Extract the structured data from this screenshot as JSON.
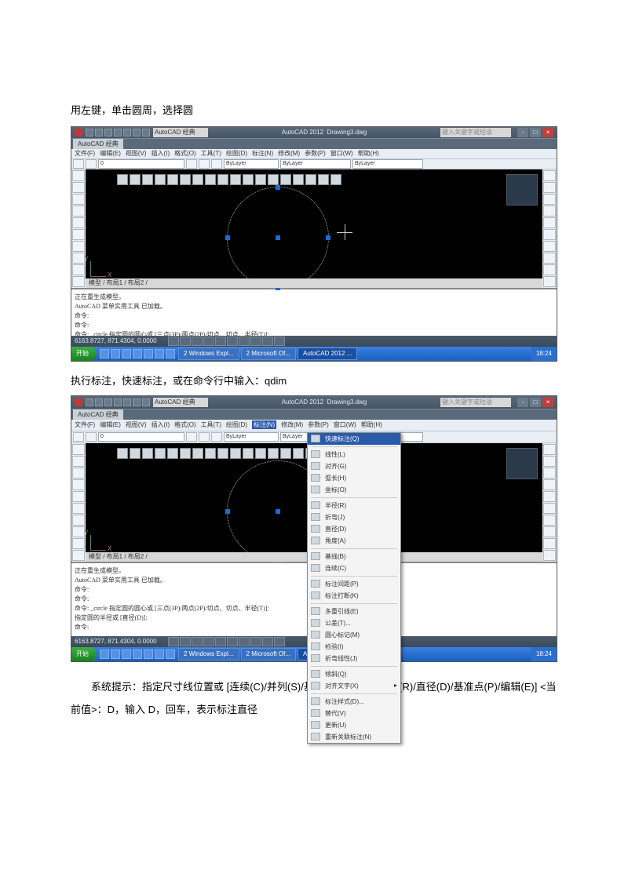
{
  "doc": {
    "instruction1": "用左键，单击圆周，选择圆",
    "instruction2": "执行标注，快速标注，或在命令行中输入：qdim",
    "para": "系统提示：指定尺寸线位置或  [连续(C)/并列(S)/基线(B)/坐标(O)/半径(R)/直径(D)/基准点(P)/编辑(E)] <当前值>：D，输入 D，回车，表示标注直径"
  },
  "app": {
    "workspace": "AutoCAD 经典",
    "title_app": "AutoCAD 2012",
    "title_file": "Drawing3.dwg",
    "search_ph": "键入关键字或短语",
    "tab": "AutoCAD 经典",
    "menubar": [
      "文件(F)",
      "编辑(E)",
      "视图(V)",
      "插入(I)",
      "格式(O)",
      "工具(T)",
      "绘图(D)",
      "标注(N)",
      "修改(M)",
      "参数(P)",
      "窗口(W)",
      "帮助(H)"
    ],
    "layer_combo": "0",
    "prop_combo1": "ByLayer",
    "prop_combo2": "ByLayer",
    "prop_combo3": "ByLayer",
    "model_tabs": "模型 / 布局1 / 布局2 /",
    "coords": "6163.8727, 871.4304, 0.0000",
    "clock": "18:24"
  },
  "cmd1": "正在重生成模型。\nAutoCAD 菜单实用工具 已加载。\n命令:\n命令:\n命令: _circle 指定圆的圆心或 [三点(3P)/两点(2P)/切点、切点、半径(T)]:\n指定圆的半径或 [直径(D)]:\n命令:",
  "cmd2": "正在重生成模型。\nAutoCAD 菜单实用工具 已加载。\n命令:\n命令:\n命令: _circle 指定圆的圆心或 [三点(3P)/两点(2P)/切点、切点、半径(T)]:\n指定圆的半径或 [直径(D)]:\n命令:\n\n\n\n\n命令:\n从选定对象中快速创建一组标注",
  "taskbar": {
    "start": "开始",
    "tasks": [
      "2 Windows Expl...",
      "2 Microsoft Of...",
      "AutoCAD 2012 ..."
    ],
    "clock": "18:24"
  },
  "dimmenu": {
    "highlight": "快速标注(Q)",
    "groups": [
      [
        "线性(L)",
        "对齐(G)",
        "弧长(H)",
        "坐标(O)"
      ],
      [
        "半径(R)",
        "折弯(J)",
        "直径(D)",
        "角度(A)"
      ],
      [
        "基线(B)",
        "连续(C)"
      ],
      [
        "标注间距(P)",
        "标注打断(K)"
      ],
      [
        "多重引线(E)",
        "公差(T)...",
        "圆心标记(M)",
        "检验(I)",
        "折弯线性(J)"
      ],
      [
        "倾斜(Q)",
        "对齐文字(X)"
      ],
      [
        "标注样式(D)...",
        "替代(V)",
        "更新(U)",
        "重新关联标注(N)"
      ]
    ]
  }
}
